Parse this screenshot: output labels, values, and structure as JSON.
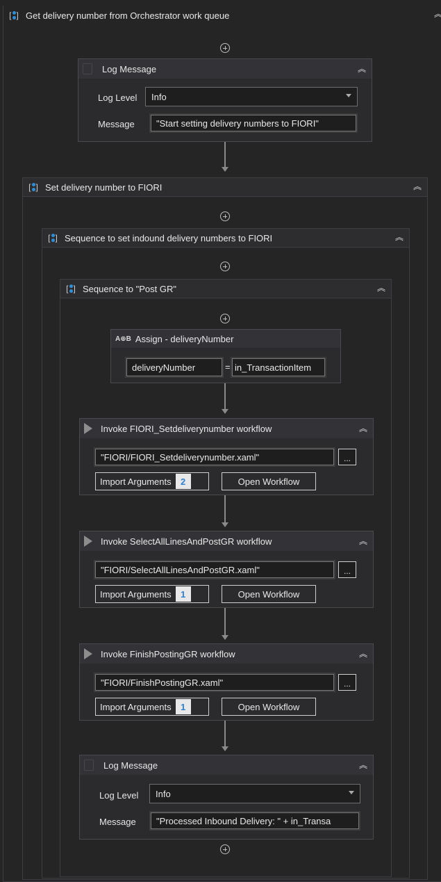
{
  "outer_sequence": {
    "title": "Get delivery number from Orchestrator work queue"
  },
  "log_message_1": {
    "title": "Log Message",
    "log_level_label": "Log Level",
    "log_level_value": "Info",
    "message_label": "Message",
    "message_value": "\"Start setting delivery numbers to FIORI\""
  },
  "set_delivery_sequence": {
    "title": "Set delivery number to FIORI"
  },
  "inbound_sequence": {
    "title": "Sequence to set indound delivery numbers to FIORI"
  },
  "post_gr_sequence": {
    "title": "Sequence to \"Post GR\""
  },
  "assign": {
    "icon_text": "A⊕B",
    "title": "Assign - deliveryNumber",
    "to": "deliveryNumber",
    "equals": "=",
    "value": "in_TransactionItem"
  },
  "invokes": [
    {
      "title": "Invoke FIORI_Setdeliverynumber workflow",
      "file": "\"FIORI/FIORI_Setdeliverynumber.xaml\"",
      "import_label": "Import Arguments",
      "import_count": "2",
      "open_label": "Open Workflow",
      "browse": "..."
    },
    {
      "title": "Invoke SelectAllLinesAndPostGR workflow",
      "file": "\"FIORI/SelectAllLinesAndPostGR.xaml\"",
      "import_label": "Import Arguments",
      "import_count": "1",
      "open_label": "Open Workflow",
      "browse": "..."
    },
    {
      "title": "Invoke FinishPostingGR workflow",
      "file": "\"FIORI/FinishPostingGR.xaml\"",
      "import_label": "Import Arguments",
      "import_count": "1",
      "open_label": "Open Workflow",
      "browse": "..."
    }
  ],
  "log_message_2": {
    "title": "Log Message",
    "log_level_label": "Log Level",
    "log_level_value": "Info",
    "message_label": "Message",
    "message_value": "\"Processed Inbound Delivery: \" + in_Transa"
  },
  "icons": {
    "collapse": "collapse-icon",
    "add": "add-activity-icon",
    "invoke": "play-icon",
    "log": "log-message-icon",
    "assign": "assign-icon",
    "sequence": "sequence-icon"
  }
}
